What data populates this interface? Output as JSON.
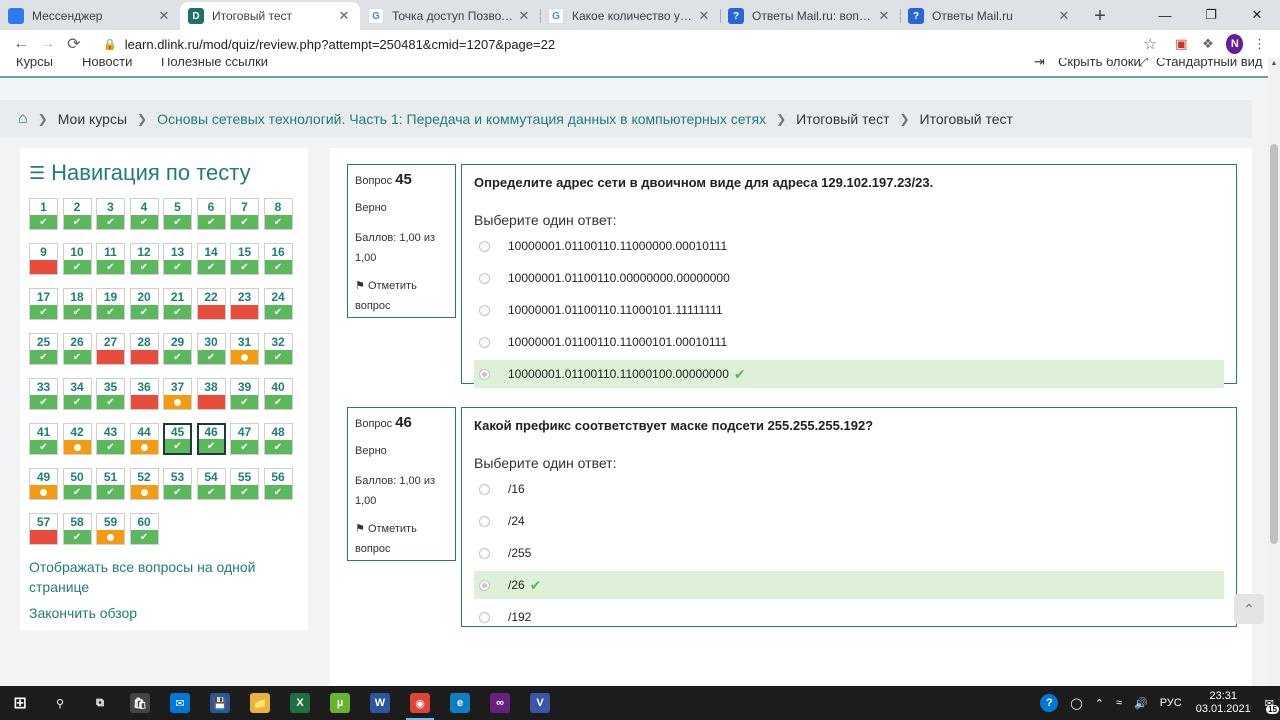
{
  "browser": {
    "tabs": [
      {
        "title": "Мессенджер",
        "favicon_color": "#2e7bf0",
        "favicon_glyph": "",
        "active": false
      },
      {
        "title": "Итоговый тест",
        "favicon_color": "#1f6f6b",
        "favicon_glyph": "D",
        "active": true
      },
      {
        "title": "Точка доступ Позволяет об",
        "favicon_color": "#ffffff",
        "favicon_glyph": "G",
        "active": false
      },
      {
        "title": "Какое количество узлов до",
        "favicon_color": "#ffffff",
        "favicon_glyph": "G",
        "active": false
      },
      {
        "title": "Ответы Mail.ru: вопрос",
        "favicon_color": "#2866d8",
        "favicon_glyph": "?",
        "active": false
      },
      {
        "title": "Ответы Mail.ru",
        "favicon_color": "#2866d8",
        "favicon_glyph": "?",
        "active": false
      }
    ],
    "url": "learn.dlink.ru/mod/quiz/review.php?attempt=250481&cmid=1207&page=22",
    "profile_initial": "N"
  },
  "site_nav": {
    "items": [
      "Курсы",
      "Новости",
      "Полезные ссылки"
    ],
    "right_items": [
      "Скрыть блоки",
      "Стандартный вид"
    ]
  },
  "breadcrumb": {
    "items": [
      {
        "label": "Мои курсы",
        "link": false
      },
      {
        "label": "Основы сетевых технологий. Часть 1: Передача и коммутация данных в компьютерных сетях",
        "link": true
      },
      {
        "label": "Итоговый тест",
        "link": false
      },
      {
        "label": "Итоговый тест",
        "link": false
      }
    ]
  },
  "quiz_nav": {
    "title": "Навигация по тесту",
    "questions": [
      {
        "n": "1",
        "s": "correct"
      },
      {
        "n": "2",
        "s": "correct"
      },
      {
        "n": "3",
        "s": "correct"
      },
      {
        "n": "4",
        "s": "correct"
      },
      {
        "n": "5",
        "s": "correct"
      },
      {
        "n": "6",
        "s": "correct"
      },
      {
        "n": "7",
        "s": "correct"
      },
      {
        "n": "8",
        "s": "correct"
      },
      {
        "n": "9",
        "s": "wrong"
      },
      {
        "n": "10",
        "s": "correct"
      },
      {
        "n": "11",
        "s": "correct"
      },
      {
        "n": "12",
        "s": "correct"
      },
      {
        "n": "13",
        "s": "correct"
      },
      {
        "n": "14",
        "s": "correct"
      },
      {
        "n": "15",
        "s": "correct"
      },
      {
        "n": "16",
        "s": "correct"
      },
      {
        "n": "17",
        "s": "correct"
      },
      {
        "n": "18",
        "s": "correct"
      },
      {
        "n": "19",
        "s": "correct"
      },
      {
        "n": "20",
        "s": "correct"
      },
      {
        "n": "21",
        "s": "correct"
      },
      {
        "n": "22",
        "s": "wrong"
      },
      {
        "n": "23",
        "s": "wrong"
      },
      {
        "n": "24",
        "s": "correct"
      },
      {
        "n": "25",
        "s": "correct"
      },
      {
        "n": "26",
        "s": "correct"
      },
      {
        "n": "27",
        "s": "wrong"
      },
      {
        "n": "28",
        "s": "wrong"
      },
      {
        "n": "29",
        "s": "correct"
      },
      {
        "n": "30",
        "s": "correct"
      },
      {
        "n": "31",
        "s": "partial"
      },
      {
        "n": "32",
        "s": "correct"
      },
      {
        "n": "33",
        "s": "correct"
      },
      {
        "n": "34",
        "s": "correct"
      },
      {
        "n": "35",
        "s": "correct"
      },
      {
        "n": "36",
        "s": "wrong"
      },
      {
        "n": "37",
        "s": "partial"
      },
      {
        "n": "38",
        "s": "wrong"
      },
      {
        "n": "39",
        "s": "correct"
      },
      {
        "n": "40",
        "s": "correct"
      },
      {
        "n": "41",
        "s": "correct"
      },
      {
        "n": "42",
        "s": "partial"
      },
      {
        "n": "43",
        "s": "correct"
      },
      {
        "n": "44",
        "s": "partial"
      },
      {
        "n": "45",
        "s": "correct",
        "current": true
      },
      {
        "n": "46",
        "s": "correct",
        "current": true
      },
      {
        "n": "47",
        "s": "correct"
      },
      {
        "n": "48",
        "s": "correct"
      },
      {
        "n": "49",
        "s": "partial"
      },
      {
        "n": "50",
        "s": "correct"
      },
      {
        "n": "51",
        "s": "correct"
      },
      {
        "n": "52",
        "s": "partial"
      },
      {
        "n": "53",
        "s": "correct"
      },
      {
        "n": "54",
        "s": "correct"
      },
      {
        "n": "55",
        "s": "correct"
      },
      {
        "n": "56",
        "s": "correct"
      },
      {
        "n": "57",
        "s": "wrong"
      },
      {
        "n": "58",
        "s": "correct"
      },
      {
        "n": "59",
        "s": "partial"
      },
      {
        "n": "60",
        "s": "correct"
      }
    ],
    "show_all_link": "Отображать все вопросы на одной странице",
    "finish_link": "Закончить обзор"
  },
  "questions": [
    {
      "label": "Вопрос",
      "number": "45",
      "state": "Верно",
      "grade": "Баллов: 1,00 из 1,00",
      "flag": "Отметить вопрос",
      "text": "Определите адрес сети в двоичном виде для адреса 129.102.197.23/23.",
      "prompt": "Выберите один ответ:",
      "answers": [
        {
          "text": "10000001.01100110.11000000.00010111",
          "selected": false
        },
        {
          "text": "10000001.01100110.00000000.00000000",
          "selected": false
        },
        {
          "text": "10000001.01100110.11000101.11111111",
          "selected": false
        },
        {
          "text": "10000001.01100110.11000101.00010111",
          "selected": false
        },
        {
          "text": "10000001.01100110.11000100.00000000",
          "selected": true
        }
      ]
    },
    {
      "label": "Вопрос",
      "number": "46",
      "state": "Верно",
      "grade": "Баллов: 1,00 из 1,00",
      "flag": "Отметить вопрос",
      "text": "Какой префикс соответствует маске подсети 255.255.255.192?",
      "prompt": "Выберите один ответ:",
      "answers": [
        {
          "text": "/16",
          "selected": false
        },
        {
          "text": "/24",
          "selected": false
        },
        {
          "text": "/255",
          "selected": false
        },
        {
          "text": "/26",
          "selected": true
        },
        {
          "text": "/192",
          "selected": false
        }
      ]
    }
  ],
  "taskbar": {
    "apps": [
      {
        "name": "search-icon",
        "glyph": "⚲",
        "color": ""
      },
      {
        "name": "task-view-icon",
        "glyph": "⧉",
        "color": ""
      },
      {
        "name": "store-icon",
        "glyph": "🛍",
        "color": "#444"
      },
      {
        "name": "mail-icon",
        "glyph": "✉",
        "color": "#0078d7"
      },
      {
        "name": "save-icon",
        "glyph": "💾",
        "color": "#2b579a"
      },
      {
        "name": "folder-icon",
        "glyph": "📁",
        "color": "#e8b33c"
      },
      {
        "name": "excel-icon",
        "glyph": "X",
        "color": "#1d6f42"
      },
      {
        "name": "utorrent-icon",
        "glyph": "µ",
        "color": "#69b42e"
      },
      {
        "name": "word-icon",
        "glyph": "W",
        "color": "#2b579a"
      },
      {
        "name": "chrome-icon",
        "glyph": "◉",
        "color": "#db4437"
      },
      {
        "name": "edge-icon",
        "glyph": "e",
        "color": "#0f7dc2"
      },
      {
        "name": "visual-studio-icon",
        "glyph": "∞",
        "color": "#68217a"
      },
      {
        "name": "visio-icon",
        "glyph": "V",
        "color": "#3955a3"
      }
    ],
    "lang": "РУС",
    "time": "23:31",
    "date": "03.01.2021",
    "notifications": "15"
  }
}
